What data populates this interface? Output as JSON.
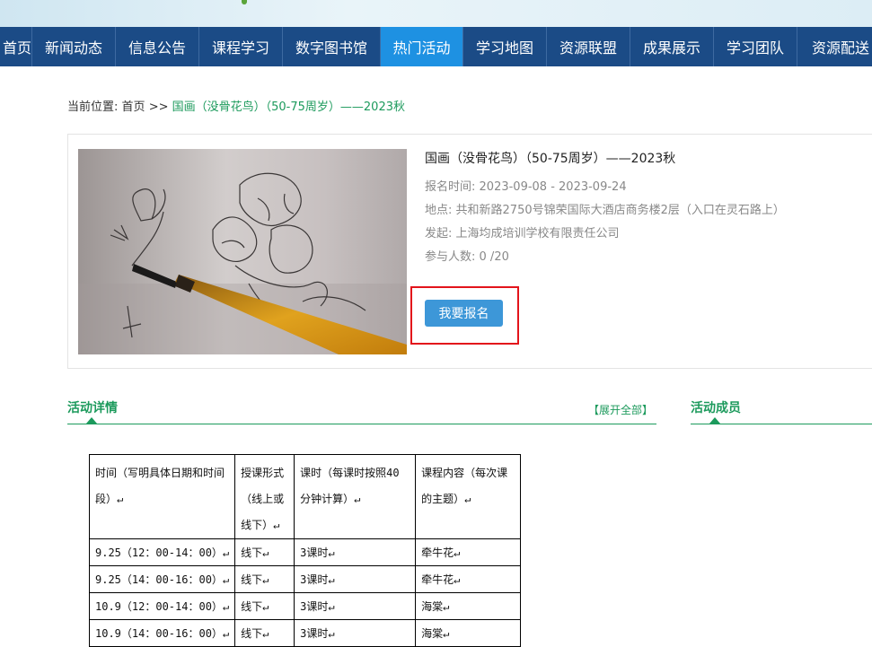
{
  "nav": {
    "items": [
      {
        "label": "首页",
        "active": false
      },
      {
        "label": "新闻动态",
        "active": false
      },
      {
        "label": "信息公告",
        "active": false
      },
      {
        "label": "课程学习",
        "active": false
      },
      {
        "label": "数字图书馆",
        "active": false
      },
      {
        "label": "热门活动",
        "active": true
      },
      {
        "label": "学习地图",
        "active": false
      },
      {
        "label": "资源联盟",
        "active": false
      },
      {
        "label": "成果展示",
        "active": false
      },
      {
        "label": "学习团队",
        "active": false
      },
      {
        "label": "资源配送",
        "active": false
      }
    ]
  },
  "breadcrumb": {
    "prefix": "当前位置:",
    "home": "首页",
    "sep": ">>",
    "current": "国画（没骨花鸟）（50-75周岁）——2023秋"
  },
  "activity": {
    "title": "国画（没骨花鸟）（50-75周岁）——2023秋",
    "signup_time_label": "报名时间:",
    "signup_time": "2023-09-08 - 2023-09-24",
    "location_label": "地点:",
    "location": "共和新路2750号锦荣国际大酒店商务楼2层（入口在灵石路上）",
    "organizer_label": "发起:",
    "organizer": "上海均成培训学校有限责任公司",
    "participants_label": "参与人数:",
    "participants": "0 /20",
    "signup_button": "我要报名"
  },
  "details": {
    "heading": "活动详情",
    "expand_label": "【展开全部】"
  },
  "members": {
    "heading": "活动成员"
  },
  "schedule": {
    "headers": [
      "时间（写明具体日期和时间段）↵",
      "授课形式（线上或线下）↵",
      "课时（每课时按照40分钟计算）↵",
      "课程内容（每次课的主题）↵"
    ],
    "rows": [
      [
        "9.25（12：00-14：00）↵",
        "线下↵",
        "3课时↵",
        "牵牛花↵"
      ],
      [
        "9.25（14：00-16：00）↵",
        "线下↵",
        "3课时↵",
        "牵牛花↵"
      ],
      [
        "10.9（12：00-14：00）↵",
        "线下↵",
        "3课时↵",
        "海棠↵"
      ],
      [
        "10.9（14：00-16：00）↵",
        "线下↵",
        "3课时↵",
        "海棠↵"
      ]
    ]
  },
  "colors": {
    "nav_bg": "#1b4b86",
    "nav_active": "#1e91e2",
    "accent_green": "#1c9a5c",
    "button_blue": "#3d97d8",
    "highlight_red": "#e3141b"
  }
}
